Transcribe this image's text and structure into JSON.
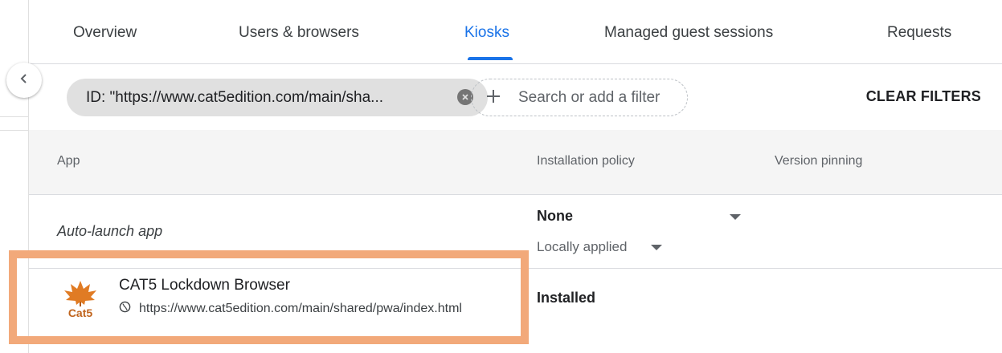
{
  "tabs": {
    "overview": "Overview",
    "users_browsers": "Users & browsers",
    "kiosks": "Kiosks",
    "managed_guest": "Managed guest sessions",
    "requests": "Requests",
    "active": "Kiosks"
  },
  "filters": {
    "chip_text": "ID: \"https://www.cat5edition.com/main/sha...",
    "add_placeholder": "Search or add a filter",
    "clear_label": "CLEAR FILTERS"
  },
  "table": {
    "headers": {
      "app": "App",
      "installation_policy": "Installation policy",
      "version_pinning": "Version pinning"
    },
    "auto_launch": {
      "label": "Auto-launch app",
      "policy_value": "None",
      "policy_source": "Locally applied"
    },
    "app_row": {
      "name": "CAT5 Lockdown Browser",
      "url": "https://www.cat5edition.com/main/shared/pwa/index.html",
      "logo_text": "Cat5",
      "installation_policy": "Installed"
    }
  },
  "colors": {
    "accent": "#1a73e8",
    "highlight": "#f2a97a",
    "logo_orange": "#e07b24"
  },
  "icons": [
    "chevron-left-icon",
    "close-circle-icon",
    "plus-icon",
    "dropdown-arrow-icon",
    "globe-icon",
    "cat5-logo"
  ]
}
